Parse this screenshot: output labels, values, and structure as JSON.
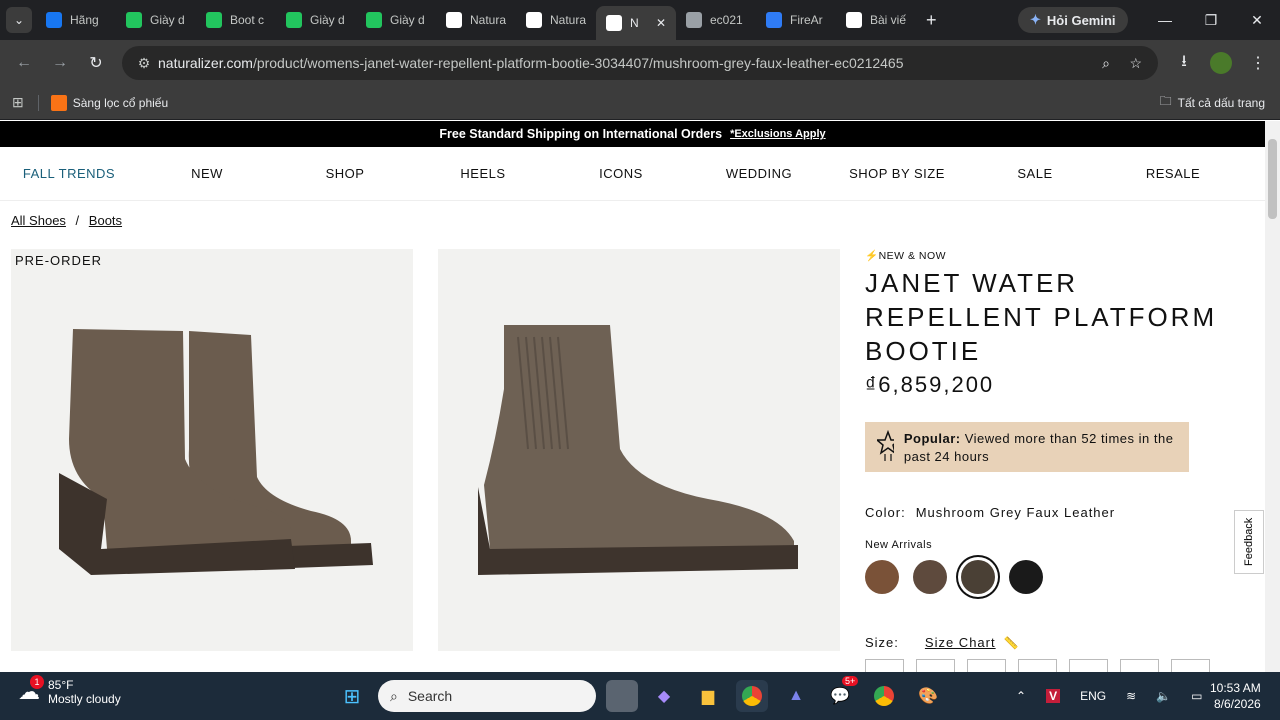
{
  "browser": {
    "tabs": [
      {
        "label": "Hãng",
        "icon": "facebook-icon",
        "color": "#1877f2"
      },
      {
        "label": "Giày d",
        "icon": "s-icon",
        "color": "#22c55e"
      },
      {
        "label": "Boot c",
        "icon": "s-icon",
        "color": "#22c55e"
      },
      {
        "label": "Giày d",
        "icon": "s-icon",
        "color": "#22c55e"
      },
      {
        "label": "Giày d",
        "icon": "s-icon",
        "color": "#22c55e"
      },
      {
        "label": "Natura",
        "icon": "google-icon",
        "color": "#ffffff"
      },
      {
        "label": "Natura",
        "icon": "naturalizer-icon",
        "color": "#ffffff"
      },
      {
        "label": "N",
        "icon": "naturalizer-icon",
        "color": "#ffffff",
        "active": true
      },
      {
        "label": "ec021",
        "icon": "globe-icon",
        "color": "#9aa0a6"
      },
      {
        "label": "FireAr",
        "icon": "firearm-icon",
        "color": "#2f7cf6"
      },
      {
        "label": "Bài viế",
        "icon": "openai-icon",
        "color": "#ffffff"
      }
    ],
    "gemini_label": "Hỏi Gemini",
    "url_host": "naturalizer.com",
    "url_path": "/product/womens-janet-water-repellent-platform-bootie-3034407/mushroom-grey-faux-leather-ec0212465",
    "bookmark": "Sàng lọc cổ phiếu",
    "all_bookmarks": "Tất cả dấu trang"
  },
  "promo": {
    "text": "Free Standard Shipping on International Orders",
    "exclusions": "*Exclusions Apply"
  },
  "nav": [
    "FALL TRENDS",
    "NEW",
    "SHOP",
    "HEELS",
    "ICONS",
    "WEDDING",
    "SHOP BY SIZE",
    "SALE",
    "RESALE"
  ],
  "breadcrumb": {
    "first": "All Shoes",
    "sep": "/",
    "second": "Boots"
  },
  "gallery": {
    "badge": "PRE-ORDER"
  },
  "product": {
    "badge": "⚡NEW & NOW",
    "title": "JANET WATER REPELLENT PLATFORM BOOTIE",
    "price": "₫6,859,200",
    "popular_label": "Popular:",
    "popular_text": "Viewed more than 52 times in the past 24 hours",
    "color_label": "Color:",
    "color_value": "Mushroom Grey Faux Leather",
    "collection_label": "New Arrivals",
    "swatches": [
      "#7a5238",
      "#5e4a3d",
      "#4a4035",
      "#1a1a1a"
    ],
    "selected_swatch": 2,
    "size_label": "Size:",
    "size_chart": "Size Chart"
  },
  "feedback": "Feedback",
  "taskbar": {
    "weather_temp": "85°F",
    "weather_desc": "Mostly cloudy",
    "weather_badge": "1",
    "search_placeholder": "Search",
    "lang": "ENG",
    "time": "10:53 AM",
    "date": "8/6/2026",
    "zalo_badge": "5+"
  }
}
